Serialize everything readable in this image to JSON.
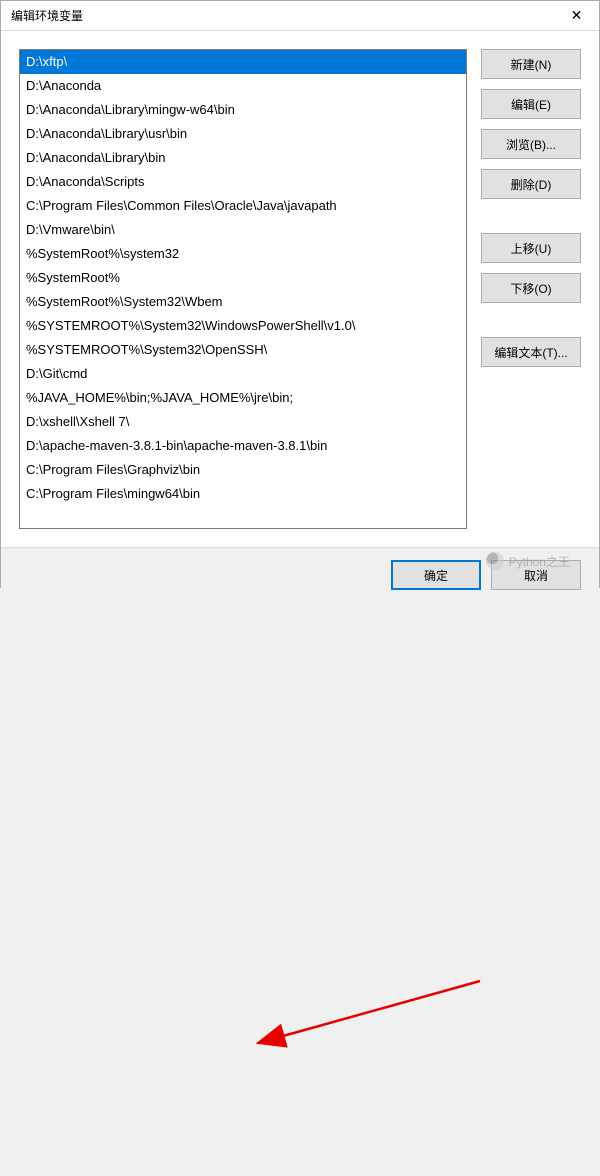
{
  "window": {
    "title": "编辑环境变量",
    "close_glyph": "✕"
  },
  "list": {
    "selected_index": 0,
    "items": [
      "D:\\xftp\\",
      "D:\\Anaconda",
      "D:\\Anaconda\\Library\\mingw-w64\\bin",
      "D:\\Anaconda\\Library\\usr\\bin",
      "D:\\Anaconda\\Library\\bin",
      "D:\\Anaconda\\Scripts",
      "C:\\Program Files\\Common Files\\Oracle\\Java\\javapath",
      "D:\\Vmware\\bin\\",
      "%SystemRoot%\\system32",
      "%SystemRoot%",
      "%SystemRoot%\\System32\\Wbem",
      "%SYSTEMROOT%\\System32\\WindowsPowerShell\\v1.0\\",
      "%SYSTEMROOT%\\System32\\OpenSSH\\",
      "D:\\Git\\cmd",
      "%JAVA_HOME%\\bin;%JAVA_HOME%\\jre\\bin;",
      "D:\\xshell\\Xshell 7\\",
      "D:\\apache-maven-3.8.1-bin\\apache-maven-3.8.1\\bin",
      "C:\\Program Files\\Graphviz\\bin",
      "C:\\Program Files\\mingw64\\bin"
    ]
  },
  "buttons": {
    "new": "新建(N)",
    "edit": "编辑(E)",
    "browse": "浏览(B)...",
    "delete": "删除(D)",
    "move_up": "上移(U)",
    "move_down": "下移(O)",
    "edit_text": "编辑文本(T)...",
    "ok": "确定",
    "cancel": "取消"
  },
  "watermark": {
    "text": "Python之王"
  }
}
